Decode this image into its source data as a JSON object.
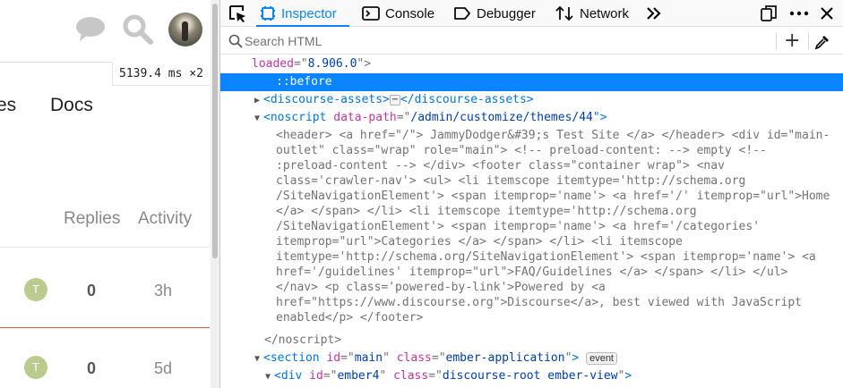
{
  "page": {
    "perf_value": "5139.4",
    "perf_unit": "ms",
    "perf_mult": "×2",
    "nav_partial": "es",
    "nav_docs": "Docs",
    "col_replies": "Replies",
    "col_activity": "Activity",
    "rows": [
      {
        "avatar_letter": "T",
        "replies": "0",
        "activity": "3h"
      },
      {
        "avatar_letter": "T",
        "replies": "0",
        "activity": "5d"
      }
    ]
  },
  "devtools": {
    "tabs": {
      "inspector": "Inspector",
      "console": "Console",
      "debugger": "Debugger",
      "network": "Network"
    },
    "search_placeholder": "Search HTML",
    "markup": {
      "line0": {
        "attr": "loaded",
        "eq": "=\"",
        "val": "8.906.0",
        "close": "\">"
      },
      "line1": {
        "pseudo": "::before"
      },
      "line2": {
        "open": "<discourse-assets>",
        "close": "</discourse-assets>",
        "ellipsis": "⋯"
      },
      "line3": {
        "open": "<noscript",
        "attr": "data-path",
        "eq": "=\"",
        "val": "/admin/customize/themes/44",
        "end": "\">"
      },
      "noscript_lines": [
        "<header> <a href=\"/\"> JammyDodger&#39;s Test Site </a> </header> <div id=\"main-",
        "outlet\" class=\"wrap\" role=\"main\"> <!-- preload-content: --> empty <!--",
        ":preload-content --> </div> <footer class=\"container wrap\"> <nav",
        "class='crawler-nav'> <ul> <li itemscope itemtype='http://schema.org",
        "/SiteNavigationElement'> <span itemprop='name'> <a href='/' itemprop=\"url\">Home",
        "</a> </span> </li> <li itemscope itemtype='http://schema.org",
        "/SiteNavigationElement'> <span itemprop='name'> <a href='/categories'",
        "itemprop=\"url\">Categories </a> </span> </li> <li itemscope",
        "itemtype='http://schema.org/SiteNavigationElement'> <span itemprop='name'> <a",
        "href='/guidelines' itemprop=\"url\">FAQ/Guidelines </a> </span> </li> </ul>",
        "</nav> <p class='powered-by-link'>Powered by <a",
        "href=\"https://www.discourse.org\">Discourse</a>, best viewed with JavaScript",
        "enabled</p> </footer>"
      ],
      "noscript_close": "</noscript>",
      "section": {
        "open": "<section",
        "id_attr": "id",
        "id_val": "main",
        "class_attr": "class",
        "class_val": "ember-application",
        "end": ">",
        "badge": "event"
      },
      "div": {
        "open": "<div",
        "id_attr": "id",
        "id_val": "ember4",
        "class_attr": "class",
        "class_val": "discourse-root ember-view",
        "end": ">"
      }
    }
  },
  "colors": {
    "accent": "#0a84ff",
    "tag": "#0074e8",
    "attr": "#c135a0",
    "value": "#003eaa",
    "avatar_green": "#b9cc8e",
    "topic_red": "#e45735"
  },
  "icons": [
    "chat-icon",
    "search-icon",
    "picker-icon",
    "inspector-icon",
    "console-icon",
    "debugger-icon",
    "network-icon",
    "more-tools-icon",
    "dock-icon",
    "menu-icon",
    "close-icon",
    "search-glass-icon",
    "add-node-icon",
    "eyedropper-icon"
  ]
}
